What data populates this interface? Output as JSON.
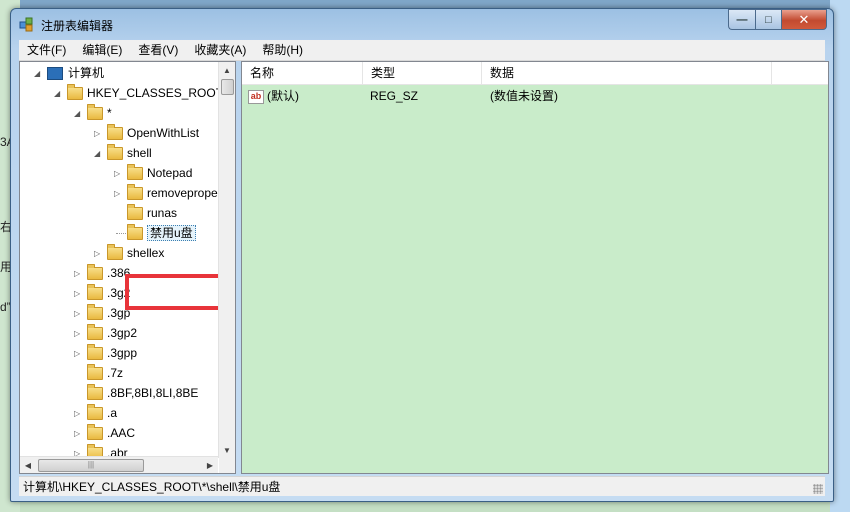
{
  "window": {
    "title": "注册表编辑器",
    "buttons": {
      "minimize": "—",
      "maximize": "□",
      "close": "✕"
    }
  },
  "background_fragments": [
    "3A",
    "右",
    "用",
    "d”"
  ],
  "menu": [
    "文件(F)",
    "编辑(E)",
    "查看(V)",
    "收藏夹(A)",
    "帮助(H)"
  ],
  "tree": {
    "computer": "计算机",
    "root": "HKEY_CLASSES_ROOT",
    "star": "*",
    "openwithlist": "OpenWithList",
    "shell": "shell",
    "notepad": "Notepad",
    "removeprope": "removeprope",
    "runas_partial": "runas",
    "selected_key": "禁用u盘",
    "shellex_partial": "shellex",
    "keys": [
      ".386",
      ".3g2",
      ".3gp",
      ".3gp2",
      ".3gpp",
      ".7z",
      ".8BF,8BI,8LI,8BE",
      ".a",
      ".AAC",
      ".abr"
    ]
  },
  "list": {
    "columns": [
      "名称",
      "类型",
      "数据"
    ],
    "rows": [
      {
        "name": "(默认)",
        "type": "REG_SZ",
        "data": "(数值未设置)",
        "icon": "ab"
      }
    ]
  },
  "statusbar": {
    "path": "计算机\\HKEY_CLASSES_ROOT\\*\\shell\\禁用u盘"
  },
  "colors": {
    "list_bg": "#c9ecca",
    "highlight": "#e8343a",
    "titlebar": "#b8d3ee"
  }
}
